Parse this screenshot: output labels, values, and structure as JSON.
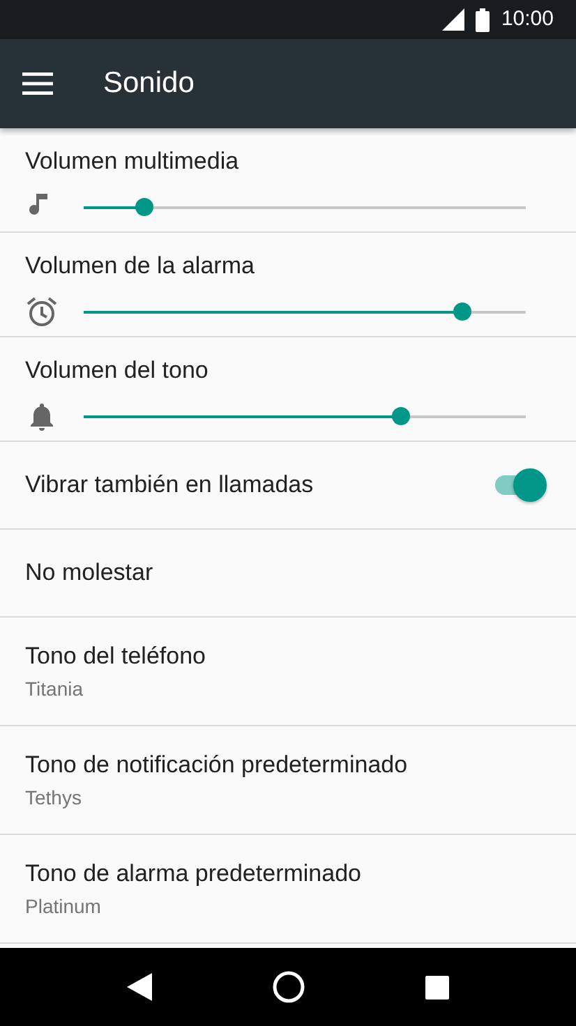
{
  "status_bar": {
    "time": "10:00"
  },
  "toolbar": {
    "title": "Sonido"
  },
  "settings": [
    {
      "kind": "slider",
      "label": "Volumen multimedia",
      "level": 0.135
    },
    {
      "kind": "slider",
      "label": "Volumen de la alarma",
      "level": 0.856
    },
    {
      "kind": "slider",
      "label": "Volumen del tono",
      "level": 0.715
    },
    {
      "kind": "switch",
      "label": "Vibrar también en llamadas",
      "on": true
    },
    {
      "kind": "item",
      "label": "No molestar"
    },
    {
      "kind": "item",
      "label": "Tono del teléfono",
      "summary": "Titania"
    },
    {
      "kind": "item",
      "label": "Tono de notificación predeterminado",
      "summary": "Tethys"
    },
    {
      "kind": "item",
      "label": "Tono de alarma predeterminado",
      "summary": "Platinum"
    }
  ]
}
